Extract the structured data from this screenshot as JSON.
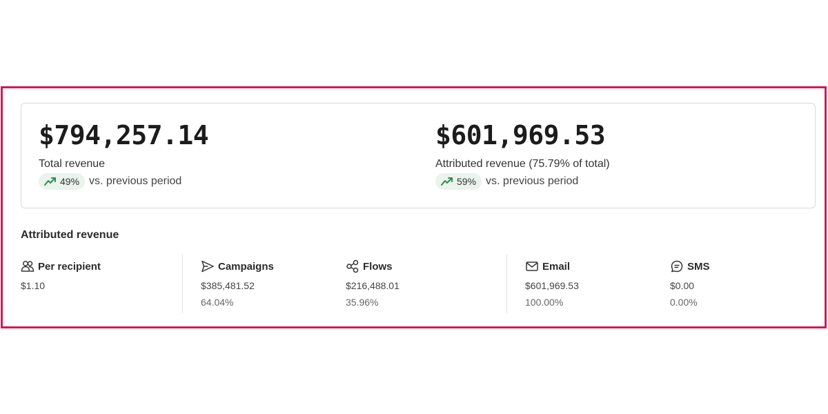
{
  "summary": {
    "total": {
      "value": "$794,257.14",
      "label": "Total revenue",
      "change": "49%",
      "change_suffix": "vs. previous period"
    },
    "attributed": {
      "value": "$601,969.53",
      "label": "Attributed revenue (75.79% of total)",
      "change": "59%",
      "change_suffix": "vs. previous period"
    },
    "trend_icon": "trending-up-icon",
    "trend_color": "#2e8b57",
    "badge_color": "#eaf3ec"
  },
  "breakdown": {
    "heading": "Attributed revenue",
    "per_recipient": {
      "label": "Per recipient",
      "value": "$1.10",
      "icon": "users-icon"
    },
    "campaigns": {
      "label": "Campaigns",
      "value": "$385,481.52",
      "percent": "64.04%",
      "icon": "send-icon"
    },
    "flows": {
      "label": "Flows",
      "value": "$216,488.01",
      "percent": "35.96%",
      "icon": "flows-icon"
    },
    "email": {
      "label": "Email",
      "value": "$601,969.53",
      "percent": "100.00%",
      "icon": "mail-icon"
    },
    "sms": {
      "label": "SMS",
      "value": "$0.00",
      "percent": "0.00%",
      "icon": "message-icon"
    }
  },
  "colors": {
    "frame_border": "#d6184f",
    "card_border": "#d9d9d9"
  }
}
